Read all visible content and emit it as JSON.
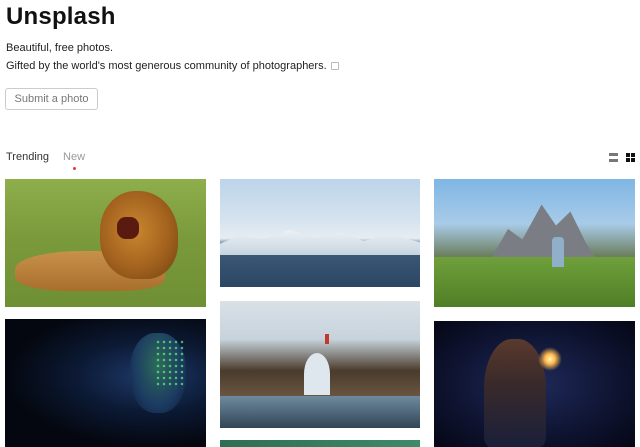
{
  "header": {
    "title": "Unsplash",
    "tagline_line1": "Beautiful, free photos.",
    "tagline_line2": "Gifted by the world's most generous community of photographers.",
    "submit_label": "Submit a photo"
  },
  "tabs": [
    {
      "label": "Trending",
      "active": false
    },
    {
      "label": "New",
      "active": true
    }
  ],
  "view_toggle": {
    "list_icon": "list-view-icon",
    "grid_icon": "grid-view-icon",
    "selected": "grid"
  },
  "colors": {
    "active_tab_dot": "#e53935",
    "title": "#111111",
    "button_border": "#cccccc"
  },
  "photos": [
    {
      "subject": "lion roaring in grass"
    },
    {
      "subject": "snowy mountains and sea"
    },
    {
      "subject": "hiker in alpine mountains"
    },
    {
      "subject": "portrait with glowing green dust"
    },
    {
      "subject": "rock arch by the sea"
    },
    {
      "subject": "person holding a sparkler"
    },
    {
      "subject": "green landscape (partially visible)"
    }
  ]
}
